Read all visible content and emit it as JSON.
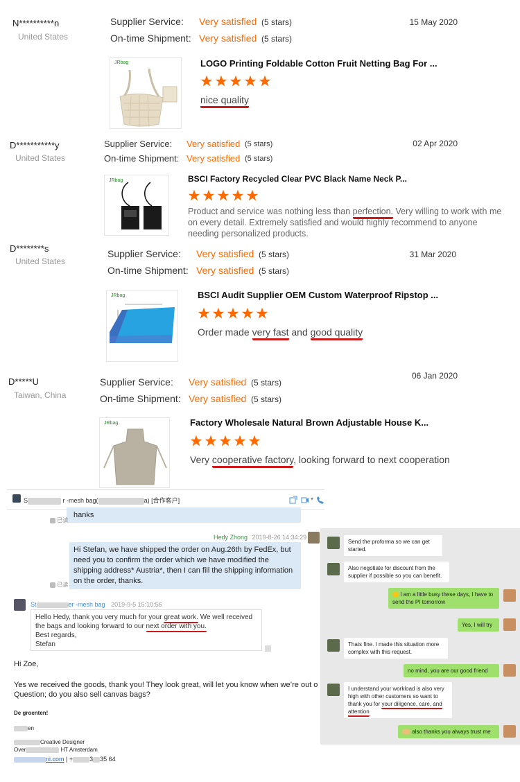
{
  "reviews": [
    {
      "name": "N**********n",
      "country": "United States",
      "service_label": "Supplier Service:",
      "service_value": "Very satisfied",
      "service_stars": "(5 stars)",
      "shipment_label": "On-time Shipment:",
      "shipment_value": "Very satisfied",
      "shipment_stars": "(5 stars)",
      "date": "15 May 2020",
      "brand": "JRbag",
      "product": "LOGO Printing Foldable Cotton Fruit Netting Bag For ...",
      "comment": "nice quality"
    },
    {
      "name": "D***********y",
      "country": "United States",
      "service_label": "Supplier Service:",
      "service_value": "Very satisfied",
      "service_stars": "(5 stars)",
      "shipment_label": "On-time Shipment:",
      "shipment_value": "Very satisfied",
      "shipment_stars": "(5 stars)",
      "date": "02 Apr 2020",
      "brand": "JRbag",
      "product": "BSCI Factory Recycled Clear PVC Black Name Neck P...",
      "comment_a": "Product and service was nothing less than ",
      "comment_u": "perfection.",
      "comment_b": "  Very willing to work with me on every detail.  Extremely satisfied and would highly recommend to anyone needing personalized products."
    },
    {
      "name": "D********s",
      "country": "United States",
      "service_label": "Supplier Service:",
      "service_value": "Very satisfied",
      "service_stars": "(5 stars)",
      "shipment_label": "On-time Shipment:",
      "shipment_value": "Very satisfied",
      "shipment_stars": "(5 stars)",
      "date": "31 Mar 2020",
      "brand": "JRbag",
      "product": "BSCI Audit Supplier OEM Custom Waterproof Ripstop ...",
      "comment_a": "Order made ",
      "comment_u1": "very fast",
      "comment_b": " and ",
      "comment_u2": "good quality"
    },
    {
      "name": "D*****U",
      "country": "Taiwan, China",
      "service_label": "Supplier Service:",
      "service_value": "Very satisfied",
      "service_stars": "(5 stars)",
      "shipment_label": "On-time Shipment:",
      "shipment_value": "Very satisfied",
      "shipment_stars": "(5 stars)",
      "date": "06 Jan 2020",
      "brand": "JRbag",
      "product": "Factory Wholesale Natural Brown Adjustable House K...",
      "comment_a": "Very ",
      "comment_u": "cooperative factory",
      "comment_b": ", looking forward to next cooperation"
    }
  ],
  "chat": {
    "header_a": "S",
    "header_b": "r -mesh bag(",
    "header_c": "a) [合作客户]",
    "read1": "已读",
    "msg1": "hanks",
    "sender2": "Hedy Zhong",
    "time2": "2019-8-26 14:34:29",
    "msg2": "Hi Stefan, we have shipped the order on Aug.26th by FedEx, but need you to confirm the order which we have modified the shipping address* Austria*, then I can fill the shipping information on the order, thanks.",
    "read2": "已读",
    "sender3_a": "St",
    "sender3_b": "er -mesh bag",
    "time3": "2019-9-5 15:10:56",
    "msg3_a": "Hello Hedy, thank you very much for your ",
    "msg3_u1": "great work.",
    "msg3_b": " We well received the bags and looking forward to our ",
    "msg3_u2": "next order with you.",
    "msg3_c": "Best regards,",
    "msg3_d": "Stefan"
  },
  "email": {
    "greeting": "Hi Zoe,",
    "body": "Yes we received the goods, thank you! They look great, will let you know when we’re out o",
    "question": "Question; do you also sell canvas bags?",
    "signoff": "De groenten!",
    "name_tail": "en",
    "role": "Creative Designer",
    "company_a": "Over",
    "company_b": "HT Amsterdam",
    "link": "ni.com",
    "sep": " | ",
    "phone_a": "+",
    "phone_b": "3",
    "phone_c": "35 64"
  },
  "phone_chat": [
    {
      "side": "left",
      "text": "Send the proforma so we can get started."
    },
    {
      "side": "left",
      "text": "Also negotiate for discount  from the supplier if possible so you can benefit."
    },
    {
      "side": "right",
      "text": "I am a little busy these days, I have to send the PI tomorrow"
    },
    {
      "side": "right",
      "text": "Yes, I will try"
    },
    {
      "side": "left",
      "text": "Thats fine. I made this situation more complex with this request."
    },
    {
      "side": "right",
      "text": "no mind, you are our good friend"
    },
    {
      "side": "left",
      "text_a": "I understand your workload is also very high with other customers so want to thank you for ",
      "text_u": "your diligence, care, and attention"
    },
    {
      "side": "right",
      "text": "also thanks you always trust me"
    }
  ],
  "colors": {
    "accent": "#ff6a00",
    "underline": "#cc1a1a",
    "star": "#ff6a00"
  }
}
